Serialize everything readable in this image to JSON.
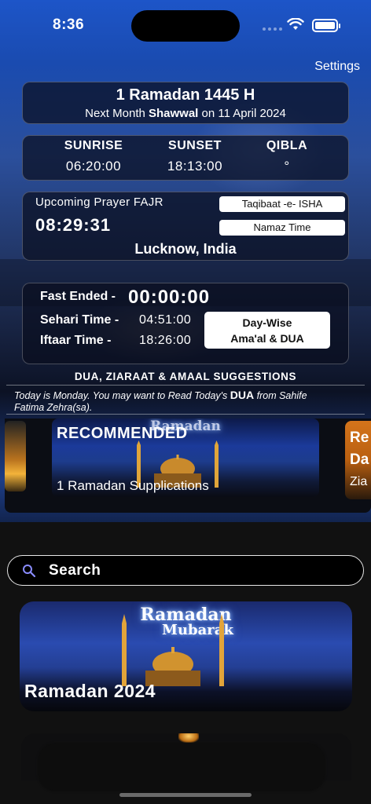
{
  "status_bar": {
    "time": "8:36"
  },
  "header": {
    "settings_label": "Settings"
  },
  "date_card": {
    "hijri_date": "1 Ramadan 1445 H",
    "next_prefix": "Next Month",
    "next_month": "Shawwal",
    "next_on": "on",
    "next_date": "11 April 2024"
  },
  "sun_card": {
    "sunrise_label": "SUNRISE",
    "sunrise_value": "06:20:00",
    "sunset_label": "SUNSET",
    "sunset_value": "18:13:00",
    "qibla_label": "QIBLA",
    "qibla_value": "°"
  },
  "prayer_card": {
    "upcoming_label": "Upcoming Prayer FAJR",
    "countdown": "08:29:31",
    "taqibaat_button": "Taqibaat -e- ISHA",
    "namaz_button": "Namaz Time",
    "location": "Lucknow, India"
  },
  "fast_card": {
    "fast_label": "Fast Ended -",
    "fast_value": "00:00:00",
    "sehari_label": "Sehari Time -",
    "sehari_value": "04:51:00",
    "iftaar_label": "Iftaar Time -",
    "iftaar_value": "18:26:00",
    "daywise_line1": "Day-Wise",
    "daywise_line2": "Ama'al & DUA"
  },
  "suggestions": {
    "title": "DUA, ZIARAAT & AMAAL SUGGESTIONS",
    "today_prefix": "Today is Monday. You may want to Read Today's",
    "today_dua": "DUA",
    "today_suffix": "from Sahife",
    "today_line2": "Fatima Zehra(sa)."
  },
  "carousel": {
    "main_title": "RECOMMENDED",
    "main_art_text": "Ramadan",
    "main_subtitle": "1 Ramadan Supplications",
    "right_line1": "Re",
    "right_line2": "Da",
    "right_line3": "Zia"
  },
  "search": {
    "placeholder": "Search"
  },
  "feature": {
    "art_line1": "Ramadan",
    "art_line2": "Mubarak",
    "title": "Ramadan 2024"
  }
}
